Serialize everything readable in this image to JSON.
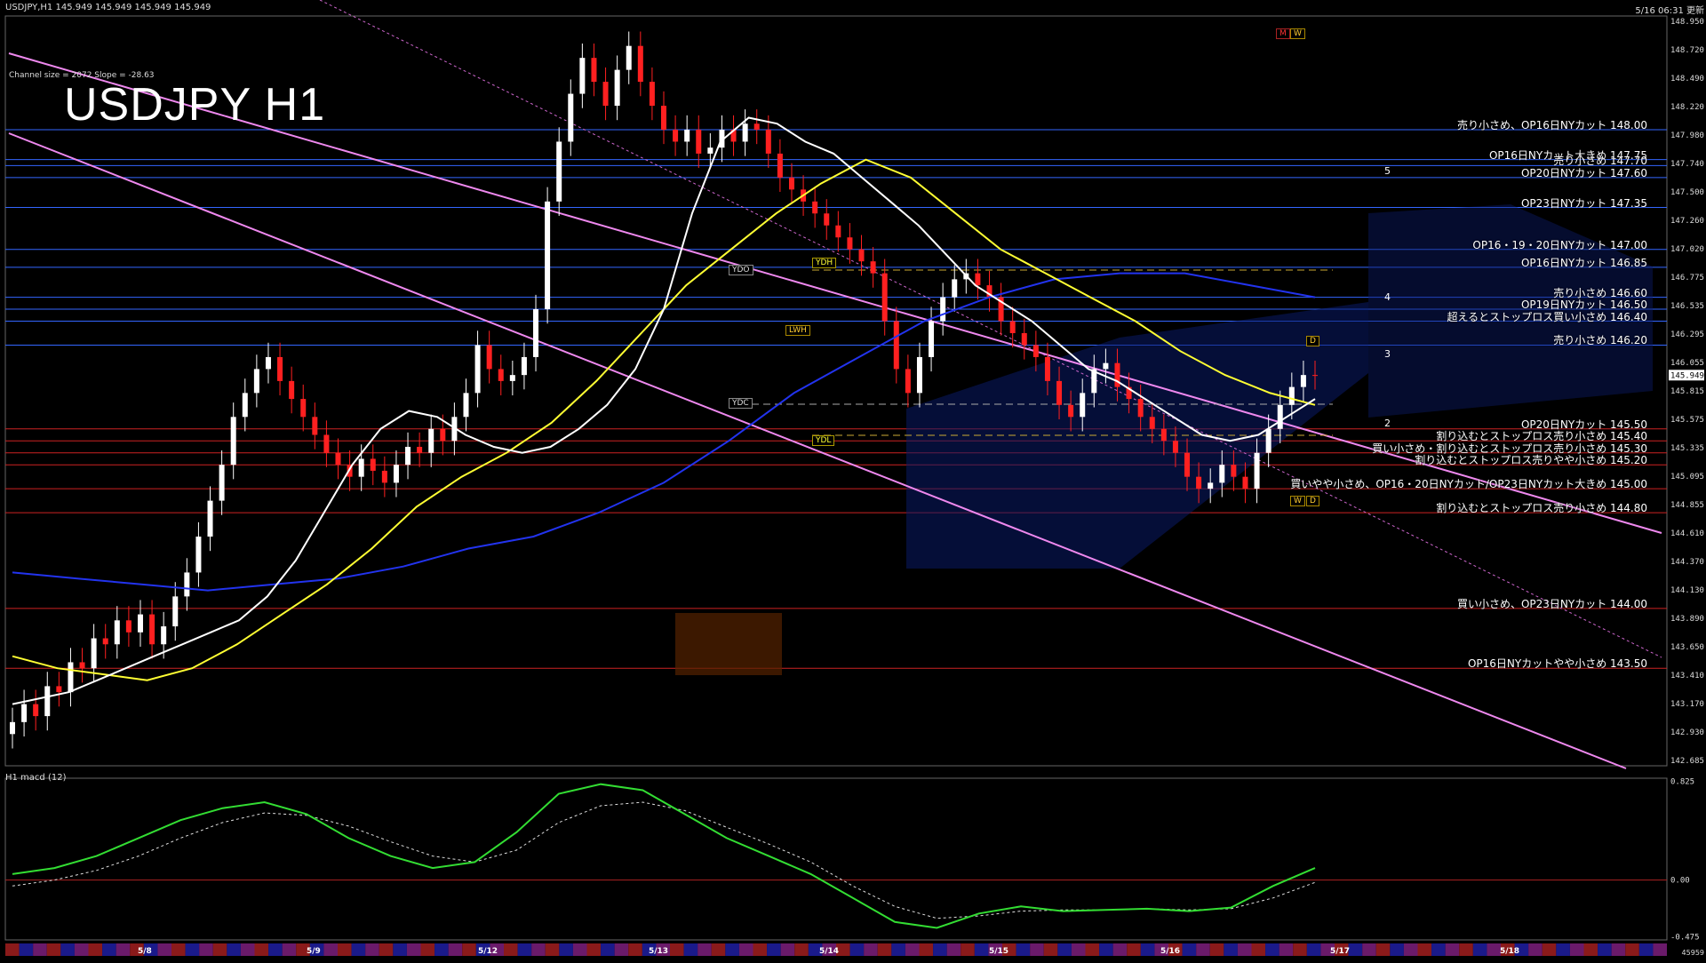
{
  "header": {
    "symbol_line": "USDJPY,H1  145.949 145.949 145.949 145.949",
    "datetime": "5/16 06:31 更新",
    "channel_info": "Channel size = 2072 Slope = -28.63",
    "big_title": "USDJPY H1",
    "macd_label": "H1  macd (12)",
    "current_price": "145.949",
    "bottom_right": "45959"
  },
  "box_tags": {
    "ydo": "YDO",
    "ydh": "YDH",
    "lwh": "LWH",
    "ydc": "YDC",
    "ydl": "YDL",
    "m": "M",
    "w": "W",
    "d": "D",
    "w2": "W",
    "d2": "D"
  },
  "wave_labels": [
    "5",
    "4",
    "3",
    "2"
  ],
  "colors": {
    "background": "#000000",
    "bull": "#ffffff",
    "bear": "#ff2020",
    "sma_white": "#ffffff",
    "sma_yellow": "#ffff33",
    "sma_blue": "#2233ee",
    "chikou": "#22cc22",
    "channel": "#ee88ee",
    "sell_level": "#3366ff",
    "buy_level": "#cc2222"
  },
  "chart_data": {
    "type": "candlestick",
    "title": "USDJPY H1",
    "ylim": [
      142.685,
      148.95
    ],
    "price_ticks": [
      "148.950",
      "148.720",
      "148.490",
      "148.220",
      "147.980",
      "147.740",
      "147.500",
      "147.260",
      "147.020",
      "146.775",
      "146.535",
      "146.295",
      "146.055",
      "145.815",
      "145.575",
      "145.335",
      "145.095",
      "144.855",
      "144.610",
      "144.370",
      "144.130",
      "143.890",
      "143.650",
      "143.410",
      "143.170",
      "142.930",
      "142.685"
    ],
    "date_labels": [
      "5/8",
      "5/9",
      "5/12",
      "5/13",
      "5/14",
      "5/15",
      "5/16",
      "5/17",
      "5/18"
    ],
    "levels": [
      {
        "label": "売り小さめ、OP16日NYカット 148.00",
        "price": 148.0,
        "color": "#3366ff"
      },
      {
        "label": "OP16日NYカット大きめ 147.75",
        "price": 147.75,
        "color": "#3366ff"
      },
      {
        "label": "売り小さめ 147.70",
        "price": 147.7,
        "color": "#3366ff"
      },
      {
        "label": "OP20日NYカット 147.60",
        "price": 147.6,
        "color": "#3366ff"
      },
      {
        "label": "OP23日NYカット 147.35",
        "price": 147.35,
        "color": "#3366ff"
      },
      {
        "label": "OP16・19・20日NYカット 147.00",
        "price": 147.0,
        "color": "#3366ff"
      },
      {
        "label": "OP16日NYカット 146.85",
        "price": 146.85,
        "color": "#3366ff"
      },
      {
        "label": "売り小さめ 146.60",
        "price": 146.6,
        "color": "#3366ff"
      },
      {
        "label": "OP19日NYカット 146.50",
        "price": 146.5,
        "color": "#3366ff"
      },
      {
        "label": "超えるとストップロス買い小さめ 146.40",
        "price": 146.4,
        "color": "#3366ff"
      },
      {
        "label": "売り小さめ 146.20",
        "price": 146.2,
        "color": "#3366ff"
      },
      {
        "label": "OP20日NYカット 145.50",
        "price": 145.5,
        "color": "#cc2222"
      },
      {
        "label": "割り込むとストップロス売り小さめ 145.40",
        "price": 145.4,
        "color": "#cc2222"
      },
      {
        "label": "買い小さめ・割り込むとストップロス売り小さめ 145.30",
        "price": 145.3,
        "color": "#cc2222"
      },
      {
        "label": "割り込むとストップロス売りやや小さめ 145.20",
        "price": 145.2,
        "color": "#cc2222"
      },
      {
        "label": "買いやや小さめ、OP16・20日NYカット/OP23日NYカット大きめ 145.00",
        "price": 145.0,
        "color": "#cc2222"
      },
      {
        "label": "割り込むとストップロス売り小さめ 144.80",
        "price": 144.8,
        "color": "#cc2222"
      },
      {
        "label": "買い小さめ、OP23日NYカット 144.00",
        "price": 144.0,
        "color": "#cc2222"
      },
      {
        "label": "OP16日NYカットやや小さめ 143.50",
        "price": 143.5,
        "color": "#cc2222"
      }
    ],
    "close_series": [
      143.05,
      143.2,
      143.1,
      143.35,
      143.3,
      143.55,
      143.5,
      143.75,
      143.7,
      143.9,
      143.8,
      143.95,
      143.7,
      143.85,
      144.1,
      144.3,
      144.6,
      144.9,
      145.2,
      145.6,
      145.8,
      146.0,
      146.1,
      145.9,
      145.75,
      145.6,
      145.45,
      145.3,
      145.2,
      145.1,
      145.25,
      145.15,
      145.05,
      145.2,
      145.35,
      145.3,
      145.5,
      145.4,
      145.6,
      145.8,
      146.2,
      146.0,
      145.9,
      145.95,
      146.1,
      146.5,
      147.4,
      147.9,
      148.3,
      148.6,
      148.4,
      148.2,
      148.5,
      148.7,
      148.4,
      148.2,
      148.0,
      147.9,
      148.0,
      147.8,
      147.85,
      148.0,
      147.9,
      148.05,
      148.0,
      147.8,
      147.6,
      147.5,
      147.4,
      147.3,
      147.2,
      147.1,
      147.0,
      146.9,
      146.8,
      146.4,
      146.0,
      145.8,
      146.1,
      146.4,
      146.6,
      146.75,
      146.8,
      146.7,
      146.6,
      146.4,
      146.3,
      146.2,
      146.1,
      145.9,
      145.7,
      145.6,
      145.8,
      146.0,
      146.05,
      145.85,
      145.75,
      145.6,
      145.5,
      145.4,
      145.3,
      145.1,
      145.0,
      145.05,
      145.2,
      145.1,
      145.0,
      145.3,
      145.5,
      145.7,
      145.85,
      145.95,
      145.949
    ],
    "sma_white": [
      143.2,
      143.25,
      143.3,
      143.4,
      143.5,
      143.6,
      143.7,
      143.8,
      143.9,
      144.1,
      144.4,
      144.8,
      145.2,
      145.5,
      145.65,
      145.6,
      145.45,
      145.35,
      145.3,
      145.35,
      145.5,
      145.7,
      146.0,
      146.5,
      147.3,
      147.9,
      148.1,
      148.05,
      147.9,
      147.8,
      147.6,
      147.4,
      147.2,
      146.95,
      146.7,
      146.55,
      146.4,
      146.2,
      146.0,
      145.9,
      145.75,
      145.6,
      145.45,
      145.4,
      145.45,
      145.6,
      145.75
    ],
    "sma_yellow": [
      143.6,
      143.5,
      143.45,
      143.4,
      143.5,
      143.7,
      143.95,
      144.2,
      144.5,
      144.85,
      145.1,
      145.3,
      145.55,
      145.9,
      146.3,
      146.7,
      147.0,
      147.3,
      147.55,
      147.75,
      147.6,
      147.3,
      147.0,
      146.8,
      146.6,
      146.4,
      146.15,
      145.95,
      145.8,
      145.7
    ],
    "sma_blue": [
      144.3,
      144.25,
      144.2,
      144.15,
      144.2,
      144.25,
      144.35,
      144.5,
      144.6,
      144.8,
      145.05,
      145.4,
      145.8,
      146.1,
      146.4,
      146.6,
      146.75,
      146.8,
      146.8,
      146.7,
      146.6
    ],
    "macd_main": [
      0.05,
      0.1,
      0.2,
      0.35,
      0.5,
      0.6,
      0.65,
      0.55,
      0.35,
      0.2,
      0.1,
      0.15,
      0.4,
      0.72,
      0.8,
      0.75,
      0.55,
      0.35,
      0.2,
      0.05,
      -0.15,
      -0.35,
      -0.4,
      -0.28,
      -0.22,
      -0.26,
      -0.25,
      -0.24,
      -0.26,
      -0.23,
      -0.05,
      0.1
    ],
    "macd_signal": [
      -0.05,
      0.0,
      0.08,
      0.2,
      0.35,
      0.48,
      0.56,
      0.54,
      0.45,
      0.32,
      0.2,
      0.15,
      0.25,
      0.48,
      0.62,
      0.65,
      0.58,
      0.44,
      0.3,
      0.15,
      -0.05,
      -0.22,
      -0.32,
      -0.3,
      -0.26,
      -0.25,
      -0.25,
      -0.24,
      -0.25,
      -0.24,
      -0.15,
      -0.02
    ],
    "macd_ticks": [
      "0.825",
      "0.00",
      "-0.475"
    ]
  }
}
